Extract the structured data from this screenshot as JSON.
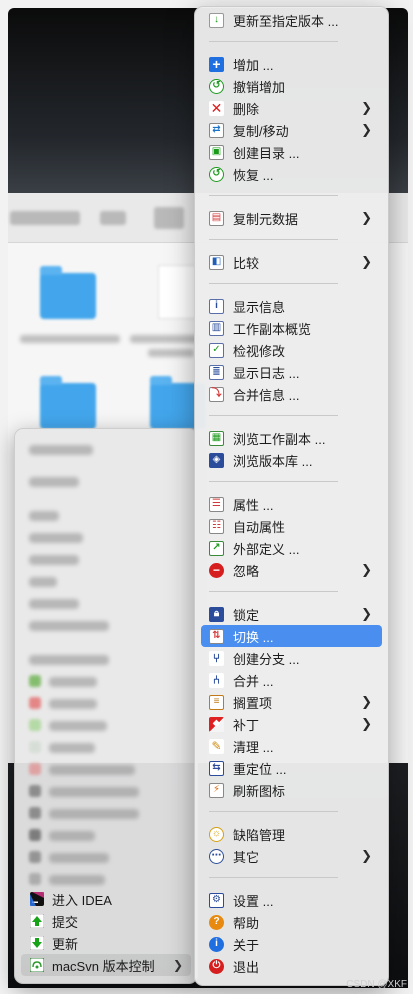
{
  "left_menu": {
    "items": [
      {
        "label": "进入 IDEA",
        "icon": "idea-icon"
      },
      {
        "label": "提交",
        "icon": "commit-icon"
      },
      {
        "label": "更新",
        "icon": "update-icon"
      },
      {
        "label": "macSvn 版本控制",
        "icon": "macsvn-icon",
        "submenu": true
      }
    ]
  },
  "svn_menu": {
    "groups": [
      [
        {
          "label": "更新至指定版本 ...",
          "icon": "update-to-revision-icon"
        }
      ],
      [
        {
          "label": "增加 ...",
          "icon": "add-icon"
        },
        {
          "label": "撤销增加",
          "icon": "revert-add-icon"
        },
        {
          "label": "删除",
          "icon": "delete-icon",
          "submenu": true
        },
        {
          "label": "复制/移动",
          "icon": "copy-move-icon",
          "submenu": true
        },
        {
          "label": "创建目录 ...",
          "icon": "create-directory-icon"
        },
        {
          "label": "恢复 ...",
          "icon": "revert-icon"
        }
      ],
      [
        {
          "label": "复制元数据",
          "icon": "copy-metadata-icon",
          "submenu": true
        }
      ],
      [
        {
          "label": "比较",
          "icon": "compare-icon",
          "submenu": true
        }
      ],
      [
        {
          "label": "显示信息",
          "icon": "show-info-icon"
        },
        {
          "label": "工作副本概览",
          "icon": "working-copy-overview-icon"
        },
        {
          "label": "检视修改",
          "icon": "check-modifications-icon"
        },
        {
          "label": "显示日志 ...",
          "icon": "show-log-icon"
        },
        {
          "label": "合并信息 ...",
          "icon": "merge-info-icon"
        }
      ],
      [
        {
          "label": "浏览工作副本 ...",
          "icon": "browse-working-copy-icon"
        },
        {
          "label": "浏览版本库 ...",
          "icon": "browse-repository-icon"
        }
      ],
      [
        {
          "label": "属性 ...",
          "icon": "properties-icon"
        },
        {
          "label": "自动属性",
          "icon": "auto-properties-icon"
        },
        {
          "label": "外部定义 ...",
          "icon": "externals-icon"
        },
        {
          "label": "忽略",
          "icon": "ignore-icon",
          "submenu": true
        }
      ],
      [
        {
          "label": "锁定",
          "icon": "lock-icon",
          "submenu": true
        },
        {
          "label": "切换 ...",
          "icon": "switch-icon",
          "highlight": true
        },
        {
          "label": "创建分支 ...",
          "icon": "create-branch-icon"
        },
        {
          "label": "合并 ...",
          "icon": "merge-icon"
        },
        {
          "label": "搁置项",
          "icon": "shelve-icon",
          "submenu": true
        },
        {
          "label": "补丁",
          "icon": "patch-icon",
          "submenu": true
        },
        {
          "label": "清理 ...",
          "icon": "cleanup-icon"
        },
        {
          "label": "重定位 ...",
          "icon": "relocate-icon"
        },
        {
          "label": "刷新图标",
          "icon": "refresh-icons-icon"
        }
      ],
      [
        {
          "label": "缺陷管理",
          "icon": "bug-tracking-icon"
        },
        {
          "label": "其它",
          "icon": "other-icon",
          "submenu": true
        }
      ],
      [
        {
          "label": "设置 ...",
          "icon": "settings-icon"
        },
        {
          "label": "帮助",
          "icon": "help-icon"
        },
        {
          "label": "关于",
          "icon": "about-icon"
        },
        {
          "label": "退出",
          "icon": "quit-icon"
        }
      ]
    ]
  },
  "watermark": "CSDN @XKF",
  "colors": {
    "highlight": "#4a8ff0",
    "menu_bg": "#ececec",
    "folder": "#43a6ec"
  }
}
